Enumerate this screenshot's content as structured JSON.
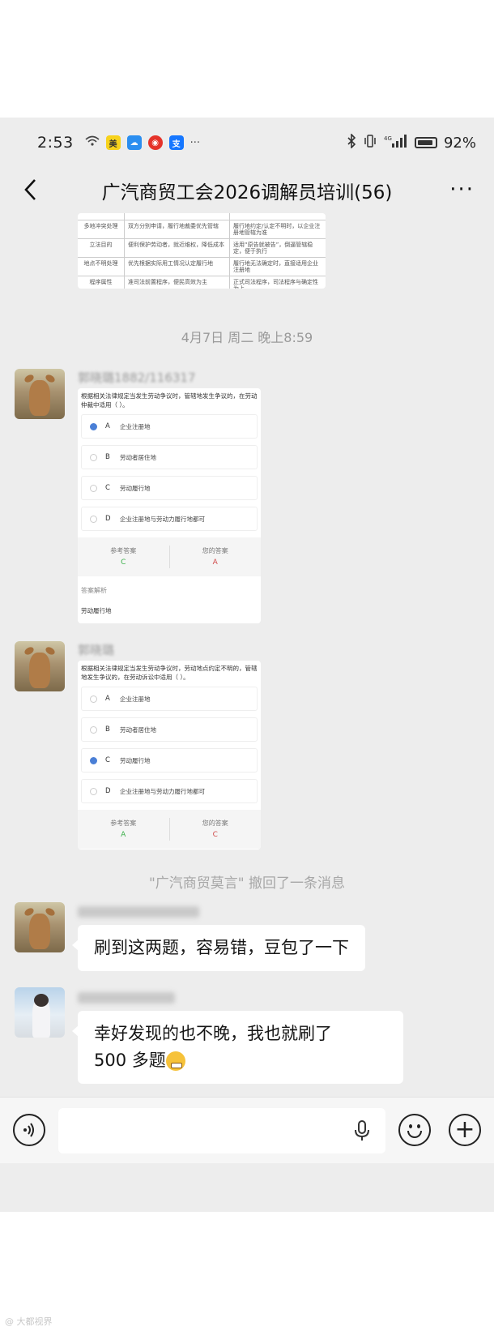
{
  "status_bar": {
    "time": "2:53",
    "battery": "92%",
    "icons": [
      "wifi-icon",
      "meituan-app-icon",
      "weather-app-icon",
      "weibo-app-icon",
      "alipay-app-icon",
      "more-dots-icon",
      "bluetooth-icon",
      "vibrate-icon",
      "signal-4g-icon",
      "battery-icon"
    ],
    "more_dots": "···"
  },
  "header": {
    "title": "广汽商贸工会2026调解员培训(56)",
    "more": "···"
  },
  "table_image": {
    "rows": [
      [
        "多地冲突处理",
        "双方分别申请，履行地裁委优先管辖",
        "履行地约定/认定不明时，以企业注册地管辖为准"
      ],
      [
        "立法目的",
        "便利保护劳动者，就近维权，降低成本",
        "适用“原告就被告”，倒逼管辖稳定，便于执行"
      ],
      [
        "地点不明处理",
        "优先根据实际用工情况认定履行地",
        "履行地无法确定时，直接适用企业注册地"
      ],
      [
        "程序属性",
        "准司法前置程序，便民高效为主",
        "正式司法程序，司法程序与确定性为上"
      ]
    ]
  },
  "timestamp": "4月7日 周二 晚上8:59",
  "quiz1": {
    "sender": "郭晓璐1882/116317",
    "question": "根据相关法律规定当发生劳动争议时，管辖地发生争议的，在劳动仲裁中适用（   ）。",
    "options": [
      {
        "letter": "A",
        "text": "企业注册地"
      },
      {
        "letter": "B",
        "text": "劳动者居住地"
      },
      {
        "letter": "C",
        "text": "劳动履行地"
      },
      {
        "letter": "D",
        "text": "企业注册地与劳动力履行地都可"
      }
    ],
    "ref_label": "参考答案",
    "ref_value": "C",
    "your_label": "您的答案",
    "your_value": "A",
    "analysis_label": "答案解析",
    "analysis_text": "劳动履行地"
  },
  "quiz2": {
    "sender": "郭晓璐",
    "question": "根据相关法律规定当发生劳动争议时，劳动地点约定不明的，管辖地发生争议的，在劳动诉讼中适用（   ）。",
    "options": [
      {
        "letter": "A",
        "text": "企业注册地"
      },
      {
        "letter": "B",
        "text": "劳动者居住地"
      },
      {
        "letter": "C",
        "text": "劳动履行地"
      },
      {
        "letter": "D",
        "text": "企业注册地与劳动力履行地都可"
      }
    ],
    "ref_label": "参考答案",
    "ref_value": "A",
    "your_label": "您的答案",
    "your_value": "C"
  },
  "recall_notice": "\"广汽商贸莫言\" 撤回了一条消息",
  "msg1": {
    "text": "刷到这两题，容易错，豆包了一下"
  },
  "msg2": {
    "text_line1": "幸好发现的也不晚，我也就刷了",
    "text_line2": "500 多题"
  },
  "input_bar": {
    "placeholder": "",
    "plus": "+"
  },
  "watermark": "@ 大都视界"
}
